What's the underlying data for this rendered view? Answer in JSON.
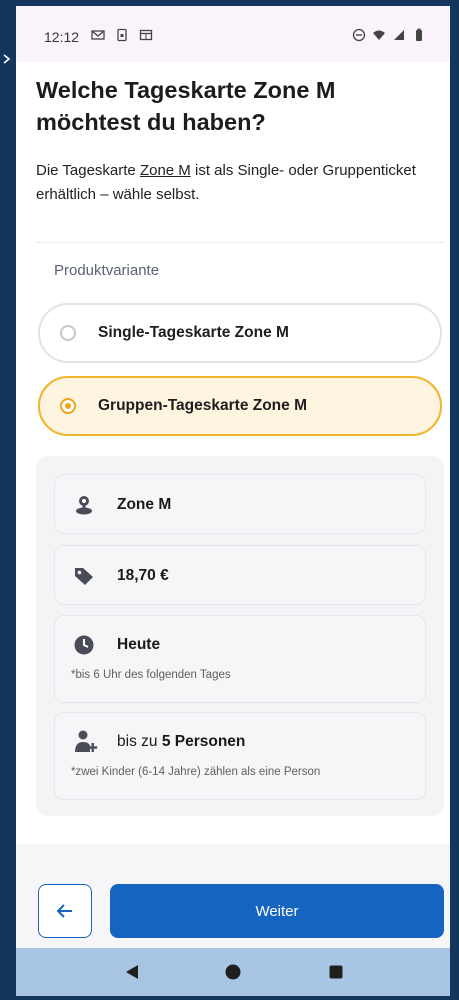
{
  "status_bar": {
    "time": "12:12",
    "left_icons": [
      "gmail-icon",
      "sim-icon",
      "calendar-icon"
    ],
    "right_icons": [
      "do-not-disturb-icon",
      "wifi-icon",
      "signal-icon",
      "battery-icon"
    ]
  },
  "heading": "Welche Tageskarte Zone M möchtest du haben?",
  "intro": {
    "before": "Die Tageskarte ",
    "link": "Zone M",
    "after": " ist als Single- oder Gruppenticket erhältlich – wähle selbst."
  },
  "product_variant": {
    "label": "Produktvariante",
    "options": [
      {
        "label": "Single-Tageskarte Zone M",
        "selected": false
      },
      {
        "label": "Gruppen-Tageskarte Zone M",
        "selected": true
      }
    ]
  },
  "details": {
    "zone": {
      "icon": "map-pin-icon",
      "label": "Zone M"
    },
    "price": {
      "icon": "price-tag-icon",
      "label": "18,70 €"
    },
    "validity": {
      "icon": "clock-icon",
      "label": "Heute",
      "note": "*bis 6 Uhr des folgenden Tages"
    },
    "persons": {
      "icon": "add-person-icon",
      "prefix": "bis zu ",
      "count": "5 Personen",
      "note": "*zwei Kinder (6-14 Jahre) zählen als eine Person"
    }
  },
  "actions": {
    "back_icon": "arrow-left-icon",
    "next_label": "Weiter"
  },
  "nav_bar": [
    "back-triangle-icon",
    "home-circle-icon",
    "recents-square-icon"
  ],
  "colors": {
    "accent_blue": "#1565c0",
    "selected_border": "#f0b429",
    "selected_bg": "#fef5e0",
    "frame": "#14355c",
    "nav_bar": "#a8c6e4"
  }
}
